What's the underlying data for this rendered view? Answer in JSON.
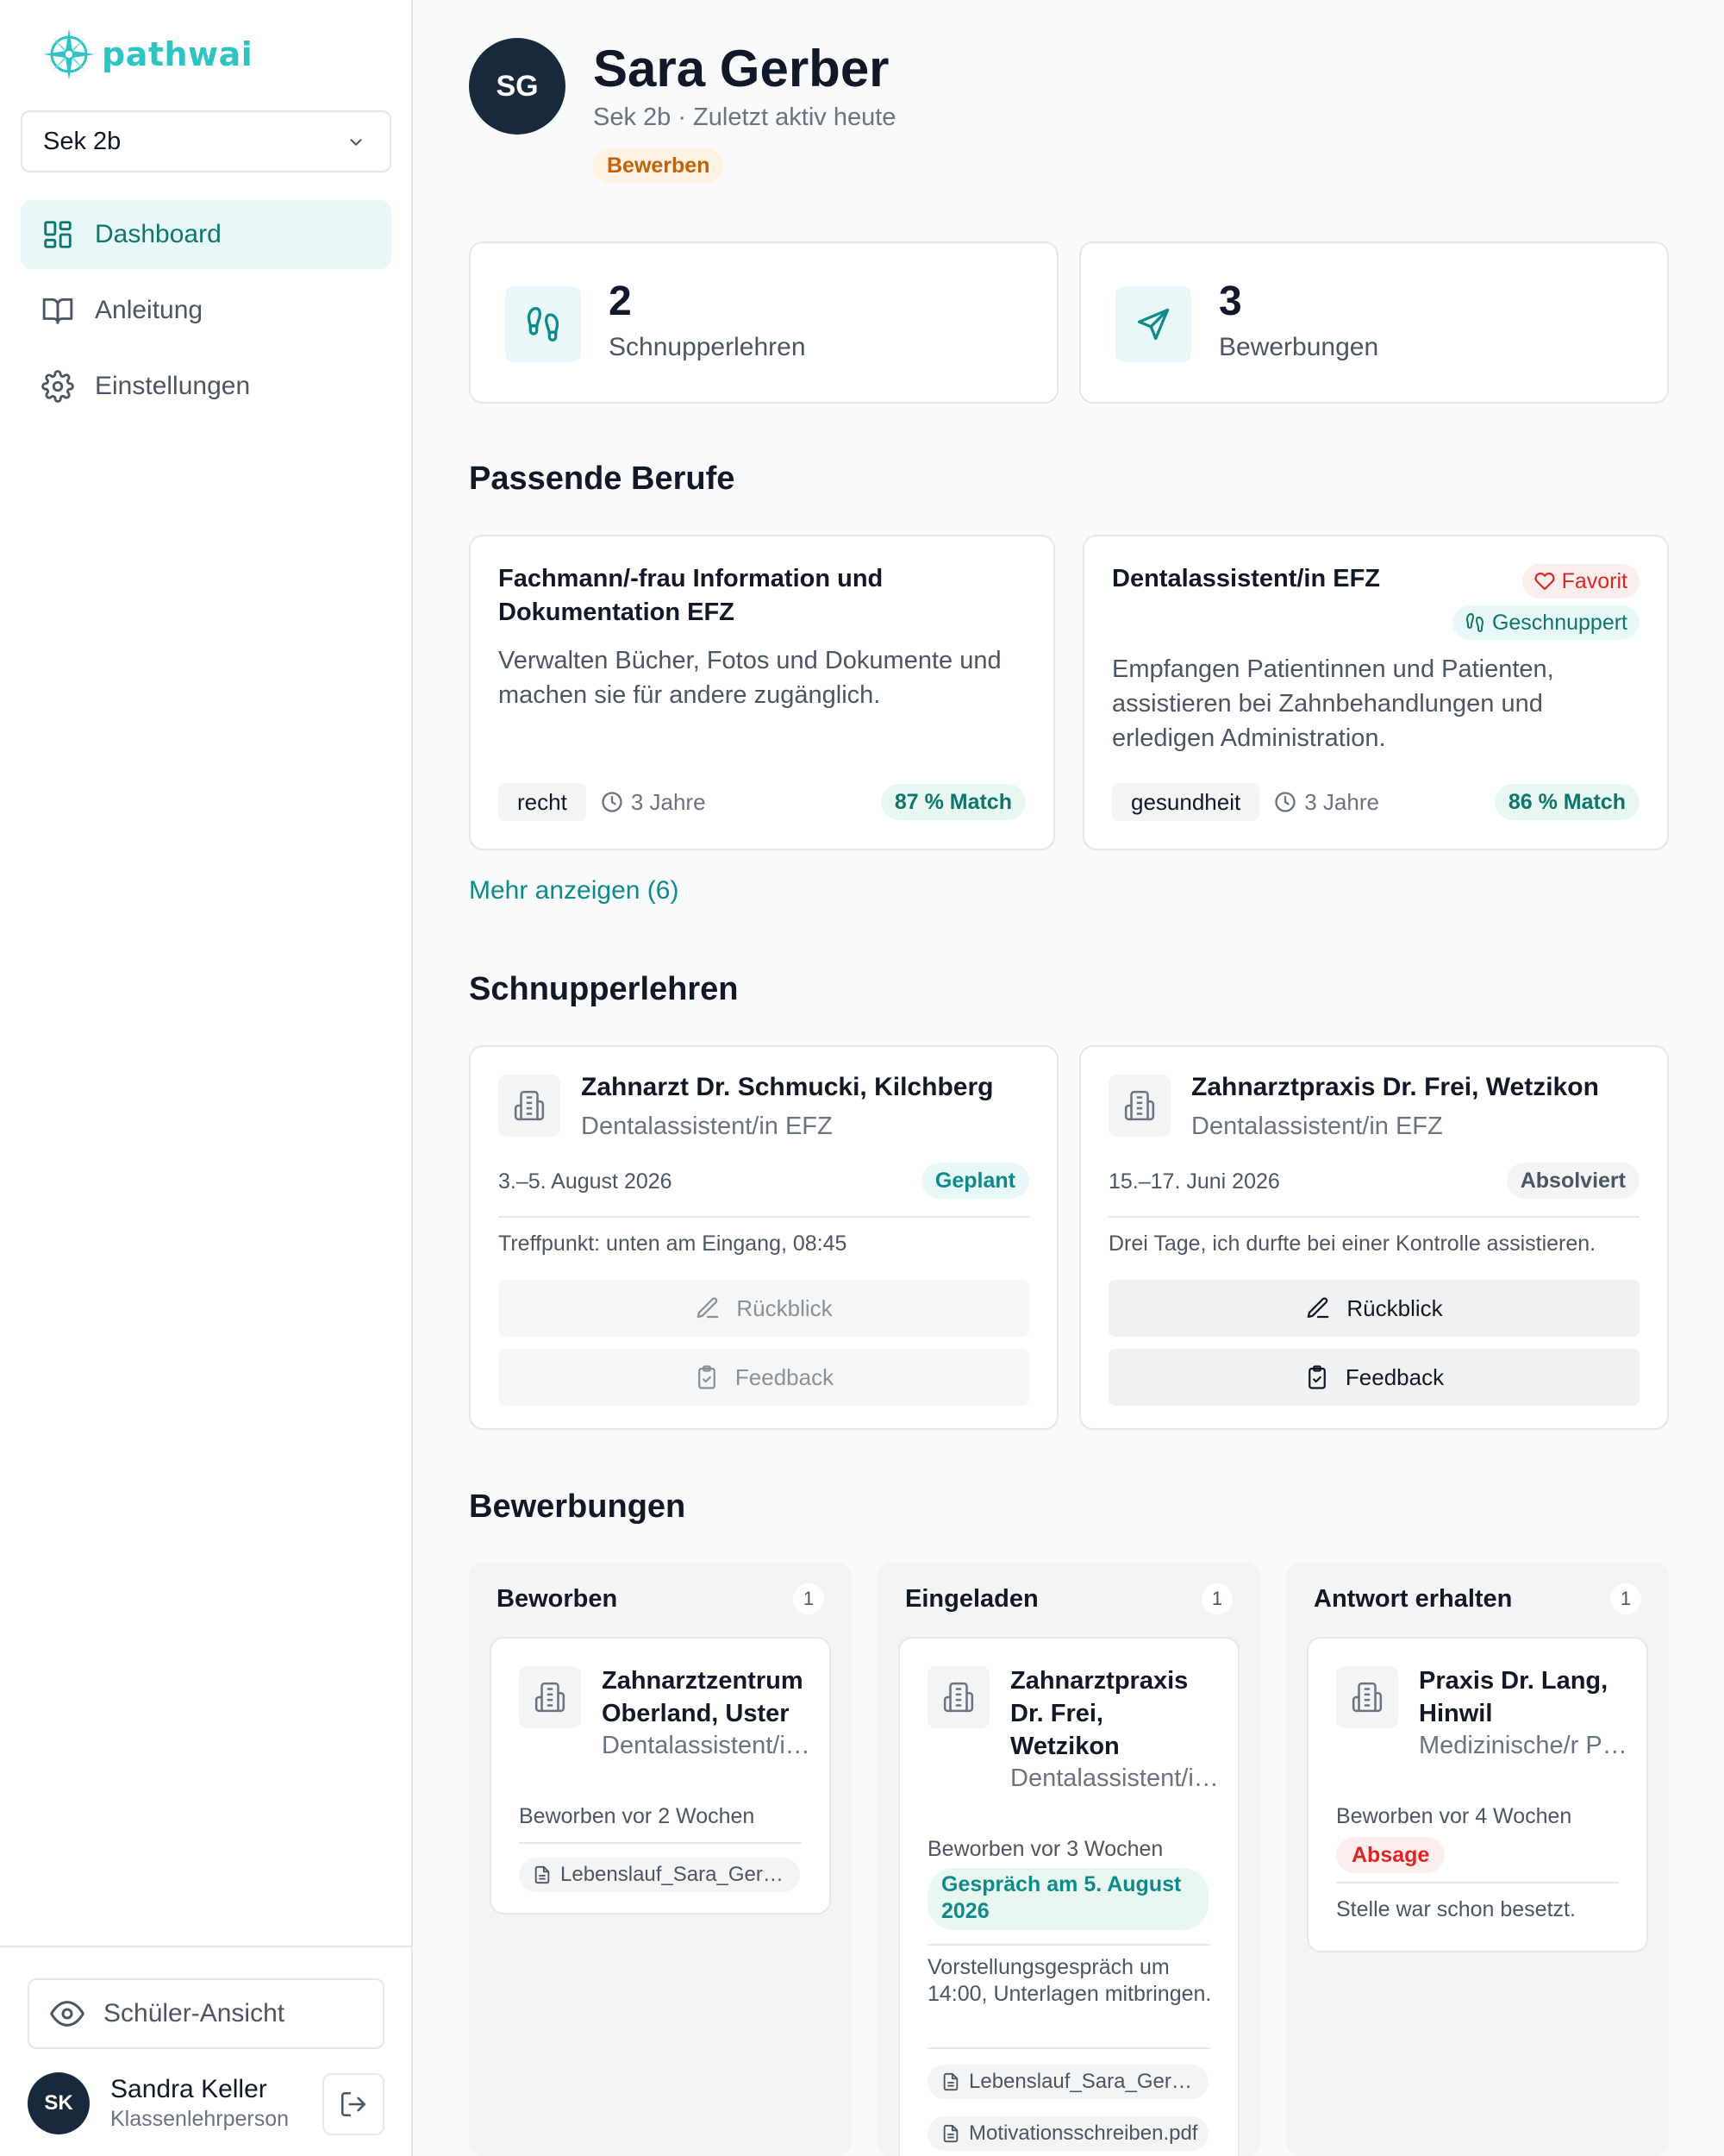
{
  "brand": {
    "name": "pathwai"
  },
  "sidebar": {
    "class_select": "Sek 2b",
    "nav": [
      {
        "label": "Dashboard",
        "icon": "dashboard-icon",
        "active": true
      },
      {
        "label": "Anleitung",
        "icon": "book-icon",
        "active": false
      },
      {
        "label": "Einstellungen",
        "icon": "gear-icon",
        "active": false
      }
    ],
    "student_view_label": "Schüler-Ansicht",
    "user": {
      "initials": "SK",
      "name": "Sandra Keller",
      "role": "Klassenlehrperson"
    }
  },
  "student": {
    "initials": "SG",
    "name": "Sara Gerber",
    "subtitle": "Sek 2b · Zuletzt aktiv heute",
    "status": "Bewerben"
  },
  "stats": [
    {
      "value": "2",
      "label": "Schnupperlehren",
      "icon": "footprints-icon"
    },
    {
      "value": "3",
      "label": "Bewerbungen",
      "icon": "send-icon"
    }
  ],
  "berufe": {
    "title": "Passende Berufe",
    "items": [
      {
        "title": "Fachmann/-frau Information und Dokumentation EFZ",
        "description": "Verwalten Bücher, Fotos und Dokumente und machen sie für andere zugänglich.",
        "tag": "recht",
        "duration": "3 Jahre",
        "match": "87 % Match"
      },
      {
        "title": "Dentalassistent/in EFZ",
        "description": "Empfangen Patientinnen und Patienten, assistieren bei Zahnbehandlungen und erledigen Administration.",
        "tag": "gesundheit",
        "duration": "3 Jahre",
        "match": "86 % Match",
        "favorite_label": "Favorit",
        "schnupper_label": "Geschnuppert"
      }
    ],
    "more_label": "Mehr anzeigen (6)"
  },
  "schnupperlehren": {
    "title": "Schnupperlehren",
    "items": [
      {
        "company": "Zahnarzt Dr. Schmucki, Kilchberg",
        "job": "Dentalassistent/in EFZ",
        "date": "3.–5. August 2026",
        "status": "Geplant",
        "note": "Treffpunkt: unten am Eingang, 08:45",
        "review_label": "Rückblick",
        "feedback_label": "Feedback"
      },
      {
        "company": "Zahnarztpraxis Dr. Frei, Wetzikon",
        "job": "Dentalassistent/in EFZ",
        "date": "15.–17. Juni 2026",
        "status": "Absolviert",
        "note": "Drei Tage, ich durfte bei einer Kontrolle assistieren.",
        "review_label": "Rückblick",
        "feedback_label": "Feedback"
      }
    ]
  },
  "bewerbungen": {
    "title": "Bewerbungen",
    "columns": [
      {
        "title": "Beworben",
        "count": "1",
        "card": {
          "company": "Zahnarztzentrum Oberland, Uster",
          "job": "Dentalassistent/in EFZ",
          "meta": "Beworben vor 2 Wochen",
          "documents": [
            "Lebenslauf_Sara_Gerber.pdf"
          ]
        }
      },
      {
        "title": "Eingeladen",
        "count": "1",
        "card": {
          "company": "Zahnarztpraxis Dr. Frei, Wetzikon",
          "job": "Dentalassistent/in EFZ",
          "meta": "Beworben vor 3 Wochen",
          "interview": "Gespräch am 5. August 2026",
          "note": "Vorstellungsgespräch um 14:00, Unterlagen mitbringen.",
          "documents": [
            "Lebenslauf_Sara_Gerber.pdf",
            "Motivationsschreiben.pdf"
          ]
        }
      },
      {
        "title": "Antwort erhalten",
        "count": "1",
        "card": {
          "company": "Praxis Dr. Lang, Hinwil",
          "job": "Medizinische/r Praxisassistent/in EFZ",
          "meta": "Beworben vor 4 Wochen",
          "result": "Absage",
          "note": "Stelle war schon besetzt."
        }
      }
    ]
  },
  "colors": {
    "accent": "#0f8a8a",
    "accent_bg": "#e8f8f8",
    "avatar": "#17293a",
    "warning": "#c2620a",
    "danger": "#dc2626"
  }
}
